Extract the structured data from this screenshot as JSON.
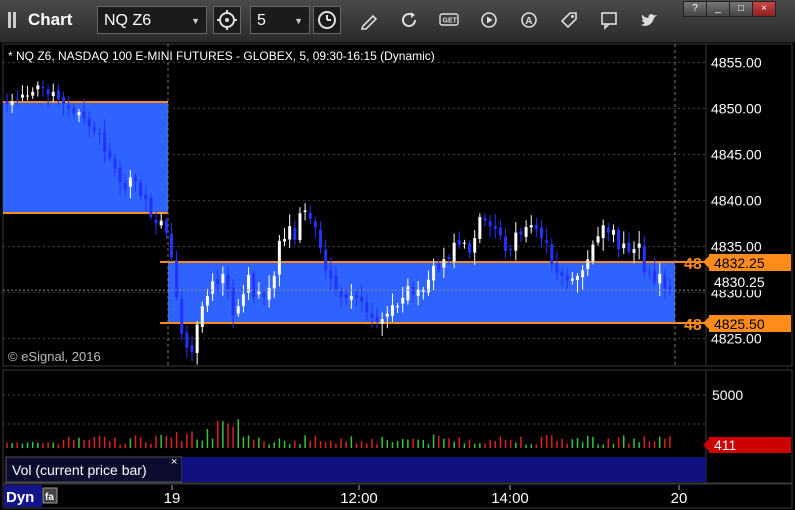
{
  "window": {
    "title": "Chart",
    "symbol": "NQ Z6",
    "interval": "5",
    "controls": [
      "?",
      "_",
      "□",
      "×"
    ]
  },
  "toolbar": {
    "icons": [
      "timeframe-icon",
      "clock-icon",
      "pencil-icon",
      "refresh-icon",
      "get-icon",
      "play-icon",
      "alert-icon",
      "tag-icon",
      "chat-icon",
      "twitter-icon"
    ]
  },
  "chart": {
    "header": "* NQ Z6, NASDAQ 100 E-MINI FUTURES - GLOBEX, 5, 09:30-16:15 (Dynamic)",
    "copyright": "© eSignal, 2016",
    "price_axis": [
      "4855.00",
      "4850.00",
      "4845.00",
      "4840.00",
      "4835.00",
      "4830.00",
      "4825.00"
    ],
    "last_price": "4830.25",
    "level_high": "4832.25",
    "level_low": "4825.50",
    "level_high_prefix": "48",
    "level_low_prefix": "48",
    "colors": {
      "zone": "#2f63ff",
      "level_line": "#ff8c1a",
      "up_bar": "#ffffff",
      "down_bar": "#2233ff",
      "vol_up": "#39c439",
      "vol_down": "#e02020",
      "last_vol": "#cc0000"
    }
  },
  "volume": {
    "axis_label": "5000",
    "current": "411",
    "study_label": "Vol (current price bar)",
    "close_label": "×"
  },
  "time_axis": {
    "mode": "Dyn",
    "labels": [
      "19",
      "12:00",
      "14:00",
      "20"
    ]
  },
  "chart_data": {
    "type": "candlestick",
    "title": "* NQ Z6, NASDAQ 100 E-MINI FUTURES - GLOBEX, 5, 09:30-16:15 (Dynamic)",
    "ylim": [
      4822,
      4857
    ],
    "y_ticks": [
      4825,
      4830,
      4835,
      4840,
      4845,
      4850,
      4855
    ],
    "x_ticks": [
      "19",
      "12:00",
      "14:00",
      "20"
    ],
    "levels": [
      4850.5,
      4838.0,
      4832.25,
      4825.5
    ],
    "last_price": 4830.25,
    "close": [
      4850.5,
      4850.8,
      4851,
      4851.5,
      4851.4,
      4851.8,
      4852.5,
      4852.2,
      4851.5,
      4851.8,
      4851,
      4850.5,
      4850,
      4849.5,
      4849.6,
      4848.9,
      4848,
      4847.5,
      4847.2,
      4845.3,
      4844.6,
      4843.4,
      4842,
      4841.2,
      4842.5,
      4842.1,
      4840.5,
      4840.1,
      4838.2,
      4837.5,
      4837.8,
      4836.5,
      4833.8,
      4829.5,
      4825.5,
      4824,
      4823.5,
      4826.5,
      4828.5,
      4829.6,
      4831.2,
      4830.9,
      4832,
      4830.3,
      4827.5,
      4828.5,
      4829.8,
      4831.9,
      4829.5,
      4830.1,
      4829.5,
      4830.5,
      4831.8,
      4835.6,
      4835.8,
      4837.2,
      4835.7,
      4838.6,
      4838.9,
      4838,
      4837.1,
      4834.8,
      4832.4,
      4831.5,
      4830.3,
      4829.5,
      4829.4,
      4829.6,
      4829.4,
      4829,
      4827.8,
      4827.3,
      4826.8,
      4827.1,
      4827.7,
      4828.6,
      4828.5,
      4829.4,
      4830.7,
      4829.8,
      4830.3,
      4830.3,
      4831.4,
      4832.9,
      4832.4,
      4833.6,
      4833.6,
      4835.4,
      4835.2,
      4835.4,
      4834.3,
      4835.9,
      4838.2,
      4837.8,
      4837.2,
      4836.9,
      4836.2,
      4834.5,
      4834.7,
      4836.5,
      4836.3,
      4837.1,
      4837.3,
      4836.9,
      4835.9,
      4835.4,
      4833.1,
      4832.1,
      4831.8,
      4831.3,
      4831.5,
      4831.8,
      4832.4,
      4833.6,
      4835.2,
      4836.1,
      4837.3,
      4836.5,
      4836.8,
      4834.7,
      4835.3,
      4834.4,
      4834.7,
      4835.3,
      4832.2,
      4832.1,
      4831.1,
      4832,
      4830.4,
      4830.3
    ],
    "volume_first_values": [
      550,
      520,
      600,
      470,
      580,
      640,
      540,
      500,
      610,
      560
    ]
  }
}
